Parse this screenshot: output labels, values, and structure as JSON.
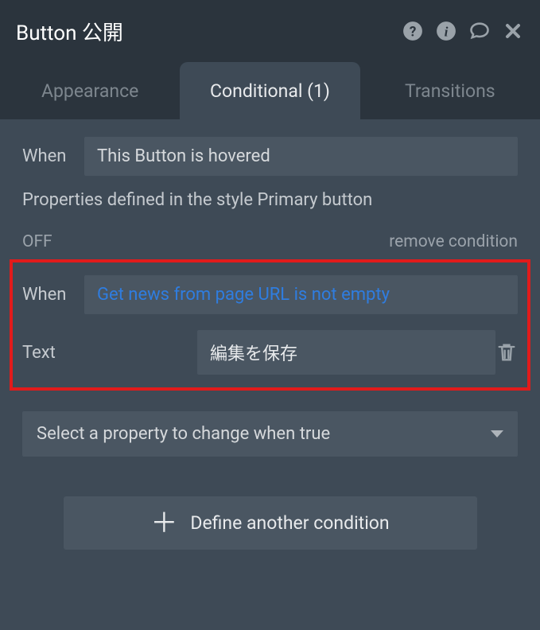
{
  "header": {
    "title": "Button 公開"
  },
  "tabs": {
    "appearance": "Appearance",
    "conditional": "Conditional (1)",
    "transitions": "Transitions"
  },
  "condition1": {
    "when_label": "When",
    "expression": "This Button is hovered",
    "style_note": "Properties defined in the style Primary button"
  },
  "condition2": {
    "status": "OFF",
    "remove_label": "remove condition",
    "when_label": "When",
    "expression": "Get news from page URL is not empty",
    "text_label": "Text",
    "text_value": "編集を保存"
  },
  "property_select": {
    "placeholder": "Select a property to change when true"
  },
  "define_button": {
    "label": "Define another condition"
  }
}
